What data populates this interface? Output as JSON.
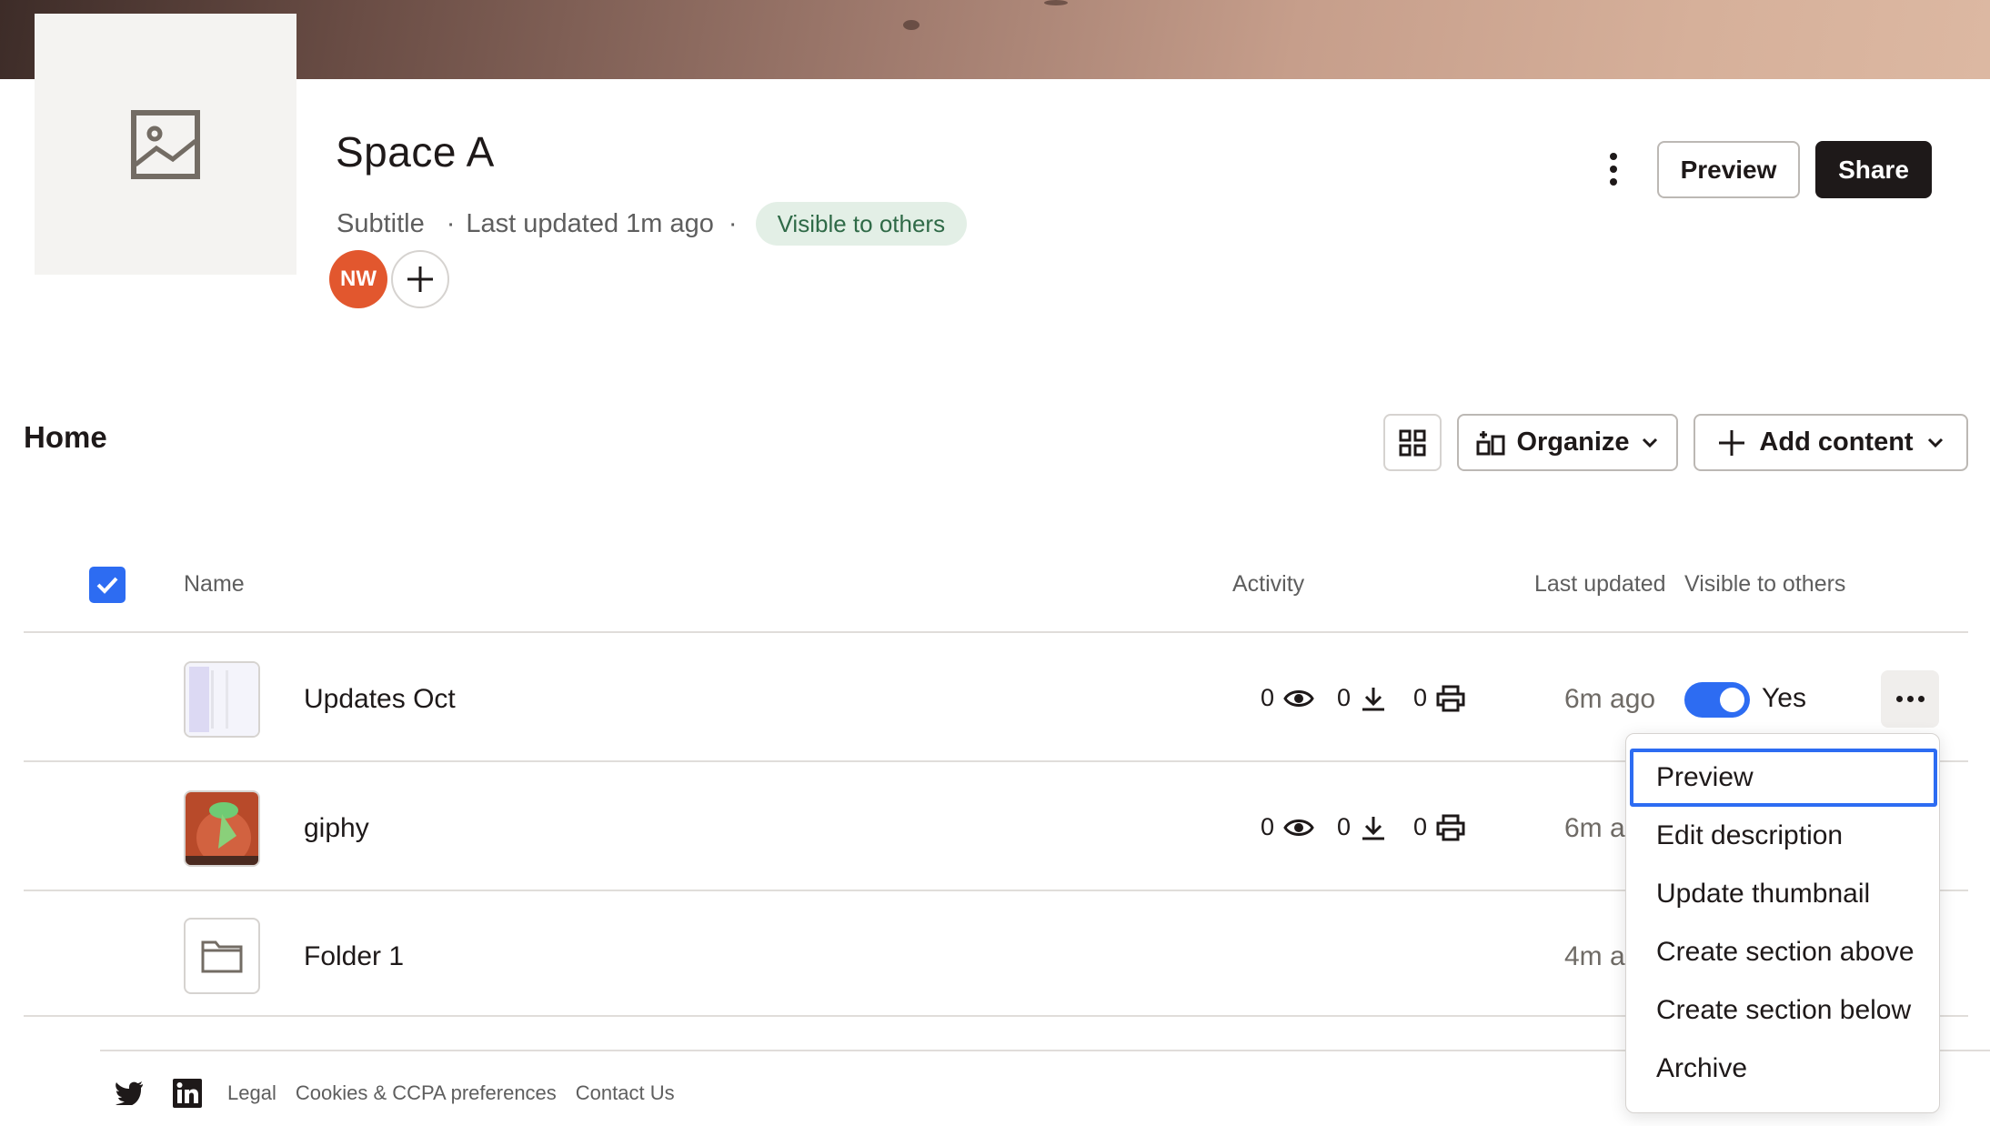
{
  "space": {
    "title": "Space A",
    "subtitle": "Subtitle",
    "separator": "·",
    "last_updated": "Last updated 1m ago",
    "visibility_pill": "Visible to others",
    "owner_initials": "NW"
  },
  "header": {
    "preview_label": "Preview",
    "share_label": "Share"
  },
  "section": {
    "title": "Home",
    "organize_label": "Organize",
    "add_content_label": "Add content"
  },
  "table": {
    "columns": {
      "name": "Name",
      "activity": "Activity",
      "last_updated": "Last updated",
      "visible": "Visible to others"
    },
    "rows": [
      {
        "name": "Updates Oct",
        "views": "0",
        "downloads": "0",
        "prints": "0",
        "updated": "6m ago",
        "visible": "Yes",
        "thumb": "document-thumbnail"
      },
      {
        "name": "giphy",
        "views": "0",
        "downloads": "0",
        "prints": "0",
        "updated": "6m a",
        "thumb": "image-thumbnail"
      },
      {
        "name": "Folder 1",
        "updated": "4m a",
        "thumb": "folder-icon"
      }
    ]
  },
  "menu": {
    "items": [
      "Preview",
      "Edit description",
      "Update thumbnail",
      "Create section above",
      "Create section below",
      "Archive"
    ]
  },
  "footer": {
    "links": [
      "Legal",
      "Cookies & CCPA preferences",
      "Contact Us"
    ]
  },
  "colors": {
    "accent": "#2d6cf2",
    "avatar": "#e2572e",
    "pill_bg": "#e3efe6",
    "pill_text": "#2f6a47",
    "share_bg": "#1e1919"
  }
}
